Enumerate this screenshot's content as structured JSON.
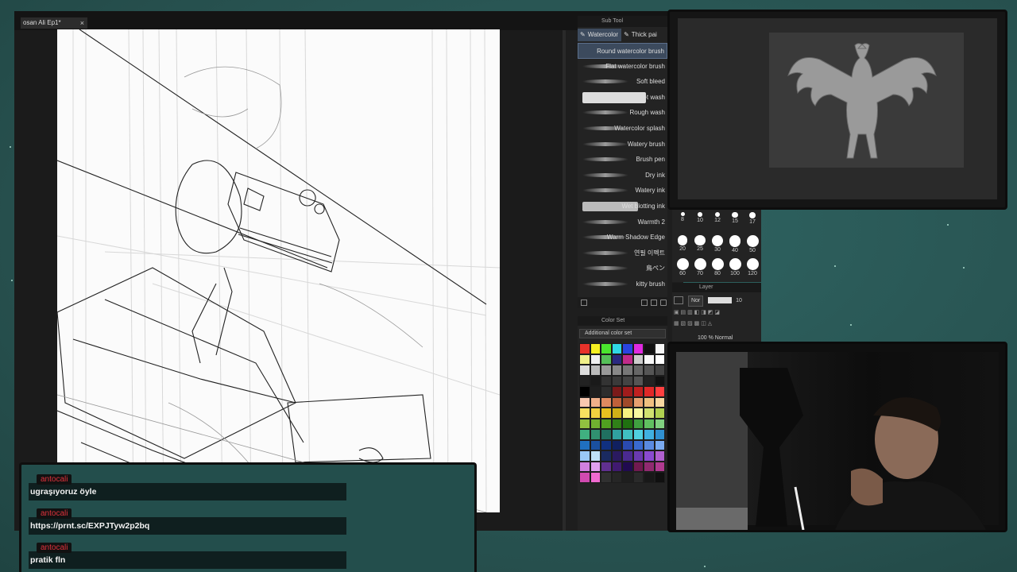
{
  "document": {
    "tab_title": "osan Ali Ep1*",
    "close_glyph": "×"
  },
  "subtool": {
    "header": "Sub Tool",
    "tabs": [
      {
        "label": "Watercolor",
        "active": true
      },
      {
        "label": "Thick pai",
        "active": false
      }
    ],
    "brushes": [
      {
        "label": "Round watercolor brush",
        "active": true
      },
      {
        "label": "Flat watercolor brush",
        "active": false
      },
      {
        "label": "Soft bleed",
        "active": false
      },
      {
        "label": "Wet wash",
        "active": false
      },
      {
        "label": "Rough wash",
        "active": false
      },
      {
        "label": "Watercolor splash",
        "active": false
      },
      {
        "label": "Watery brush",
        "active": false
      },
      {
        "label": "Brush pen",
        "active": false
      },
      {
        "label": "Dry ink",
        "active": false
      },
      {
        "label": "Watery ink",
        "active": false
      },
      {
        "label": "Wet blotting ink",
        "active": false
      },
      {
        "label": "Warmth 2",
        "active": false
      },
      {
        "label": "Warm Shadow Edge",
        "active": false
      },
      {
        "label": "연필 이펙트",
        "active": false
      },
      {
        "label": "鳥ペン",
        "active": false
      },
      {
        "label": "kitty brush",
        "active": false
      }
    ]
  },
  "colorset": {
    "header": "Color Set",
    "dropdown_value": "Additional color set",
    "colors": [
      "#e8322a",
      "#f6f022",
      "#4ae62e",
      "#2fd9e6",
      "#2a44e0",
      "#e02ae0",
      "#111111",
      "#f6f6f6",
      "#f0f08a",
      "#f0f0f0",
      "#55c058",
      "#2a2a80",
      "#c02a8a",
      "#cccccc",
      "#f8f8f8",
      "#ffffff",
      "#dddddd",
      "#bbbbbb",
      "#999999",
      "#888888",
      "#777777",
      "#666666",
      "#555555",
      "#444444",
      "#222222",
      "#1a1a1a",
      "#333333",
      "#3a3a3a",
      "#444444",
      "#555555",
      "#222222",
      "#111111",
      "#000000",
      "#1f1f1f",
      "#2d2d2d",
      "#7a1a1a",
      "#a01c1c",
      "#c02020",
      "#e02828",
      "#ff4040",
      "#f8c8b0",
      "#f0b08a",
      "#e08a60",
      "#c0603a",
      "#a04a2a",
      "#e8a070",
      "#f0c080",
      "#f8d8a0",
      "#f8e060",
      "#f0d040",
      "#e8c020",
      "#d0b018",
      "#f8f080",
      "#f8f8a0",
      "#d0e070",
      "#b0d050",
      "#90c040",
      "#70b030",
      "#50a020",
      "#308018",
      "#207010",
      "#40a040",
      "#60c060",
      "#80d080",
      "#40b080",
      "#309070",
      "#207060",
      "#30a0a0",
      "#40c0c0",
      "#50d0e0",
      "#40b0e0",
      "#3090d0",
      "#2070c0",
      "#1a50a0",
      "#103080",
      "#102060",
      "#2a4ab0",
      "#3a6ad0",
      "#5a8ae0",
      "#7aaaf0",
      "#9ac8f8",
      "#c0e0f8",
      "#1a2a60",
      "#2a1a60",
      "#4a2a90",
      "#6a3ab0",
      "#8a4ad0",
      "#b060d0",
      "#d080e0",
      "#e0a0f0",
      "#603090",
      "#401a70",
      "#200a50",
      "#701a50",
      "#902a70",
      "#b03a90",
      "#d04ab0",
      "#f06ad0",
      "#303030",
      "#262626",
      "#1e1e1e",
      "#2a2a2a",
      "#181818",
      "#101010"
    ]
  },
  "brush_sizes": [
    "8",
    "10",
    "12",
    "15",
    "17",
    "20",
    "25",
    "30",
    "40",
    "50",
    "60",
    "70",
    "80",
    "100",
    "120"
  ],
  "layer": {
    "header": "Layer",
    "blend_mode": "Nor",
    "opacity_value": "10",
    "layer_row": "100 % Normal"
  },
  "chat": {
    "messages": [
      {
        "user": "antocali",
        "text": "ugraşıyoruz öyle"
      },
      {
        "user": "antocali",
        "text": "https://prnt.sc/EXPJTyw2p2bq"
      },
      {
        "user": "antocali",
        "text": "pratik fln"
      }
    ]
  }
}
